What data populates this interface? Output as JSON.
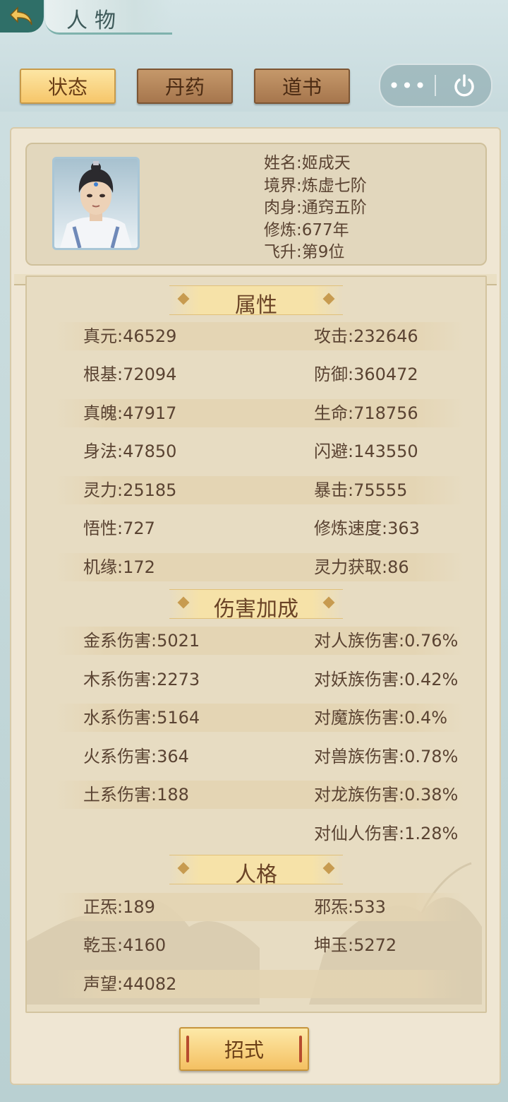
{
  "header": {
    "title": "人物"
  },
  "tabs": [
    {
      "label": "状态",
      "active": true
    },
    {
      "label": "丹药",
      "active": false
    },
    {
      "label": "道书",
      "active": false
    }
  ],
  "top_actions": {
    "more_label": "•••"
  },
  "profile": {
    "name_line": "姓名:姬成天",
    "realm_line": "境界:炼虚七阶",
    "body_line": "肉身:通窍五阶",
    "cultivation_line": "修炼:677年",
    "ascension_line": "飞升:第9位"
  },
  "sections": {
    "attributes": {
      "title": "属性",
      "rows": [
        {
          "left": "真元:46529",
          "right": "攻击:232646"
        },
        {
          "left": "根基:72094",
          "right": "防御:360472"
        },
        {
          "left": "真魄:47917",
          "right": "生命:718756"
        },
        {
          "left": "身法:47850",
          "right": "闪避:143550"
        },
        {
          "left": "灵力:25185",
          "right": "暴击:75555"
        },
        {
          "left": "悟性:727",
          "right": "修炼速度:363"
        },
        {
          "left": "机缘:172",
          "right": "灵力获取:86"
        }
      ]
    },
    "damage": {
      "title": "伤害加成",
      "rows": [
        {
          "left": "金系伤害:5021",
          "right": "对人族伤害:0.76%"
        },
        {
          "left": "木系伤害:2273",
          "right": "对妖族伤害:0.42%"
        },
        {
          "left": "水系伤害:5164",
          "right": "对魔族伤害:0.4%"
        },
        {
          "left": "火系伤害:364",
          "right": "对兽族伤害:0.78%"
        },
        {
          "left": "土系伤害:188",
          "right": "对龙族伤害:0.38%"
        },
        {
          "left": "",
          "right": "对仙人伤害:1.28%"
        }
      ]
    },
    "personality": {
      "title": "人格",
      "rows": [
        {
          "left": "正炁:189",
          "right": "邪炁:533"
        },
        {
          "left": "乾玉:4160",
          "right": "坤玉:5272"
        },
        {
          "left": "声望:44082",
          "right": ""
        }
      ]
    }
  },
  "bottom": {
    "skill_button": "招式"
  }
}
